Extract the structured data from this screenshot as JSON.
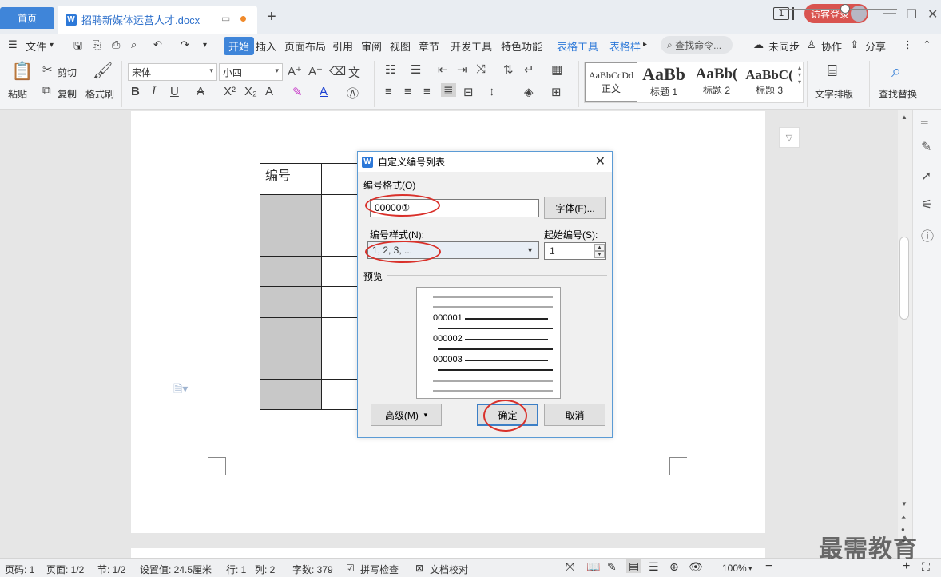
{
  "titlebar": {
    "home_tab": "首页",
    "doc_tab_badge": "W",
    "doc_tab_title": "招聘新媒体运营人才.docx",
    "new_tab": "+",
    "page_indicator": "1",
    "guest_login": "访客登录",
    "window": {
      "minimize": "—",
      "maximize": "☐",
      "close": "✕"
    }
  },
  "menubar": {
    "file": "文件",
    "items": [
      "开始",
      "插入",
      "页面布局",
      "引用",
      "审阅",
      "视图",
      "章节",
      "开发工具",
      "特色功能"
    ],
    "table_tools": "表格工具",
    "table_style": "表格样",
    "search": "查找命令...",
    "unsynced": "未同步",
    "collab": "协作",
    "share": "分享"
  },
  "ribbon": {
    "paste": "粘贴",
    "cut": "剪切",
    "copy": "复制",
    "format_painter": "格式刷",
    "font_name": "宋体",
    "font_size": "小四",
    "styles": [
      {
        "sample": "AaBbCcDd",
        "label": "正文"
      },
      {
        "sample": "AaBb",
        "label": "标题 1"
      },
      {
        "sample": "AaBb(",
        "label": "标题 2"
      },
      {
        "sample": "AaBbC(",
        "label": "标题 3"
      }
    ],
    "text_layout": "文字排版",
    "find_replace": "查找替换"
  },
  "document": {
    "table_header": "编号",
    "rows": 7
  },
  "dialog": {
    "badge": "W",
    "title": "自定义编号列表",
    "format_label": "编号格式(O)",
    "format_value": "00000①",
    "font_button": "字体(F)...",
    "style_label": "编号样式(N):",
    "style_value": "1, 2, 3, ...",
    "start_label": "起始编号(S):",
    "start_value": "1",
    "preview_label": "预览",
    "preview_numbers": [
      "000001",
      "000002",
      "000003"
    ],
    "advanced_button": "高级(M)",
    "ok_button": "确定",
    "cancel_button": "取消"
  },
  "statusbar": {
    "page_num": "页码: 1",
    "page_count": "页面: 1/2",
    "section": "节: 1/2",
    "setting": "设置值: 24.5厘米",
    "line": "行: 1",
    "column": "列: 2",
    "word_count": "字数: 379",
    "spell_check": "拼写检查",
    "doc_review": "文档校对",
    "zoom": "100%",
    "zoom_level": 0.56
  },
  "watermark": "最需教育",
  "colors": {
    "accent": "#3f85d9",
    "highlight_circle": "#d9302a",
    "table_shade": "#c8c8c8"
  }
}
